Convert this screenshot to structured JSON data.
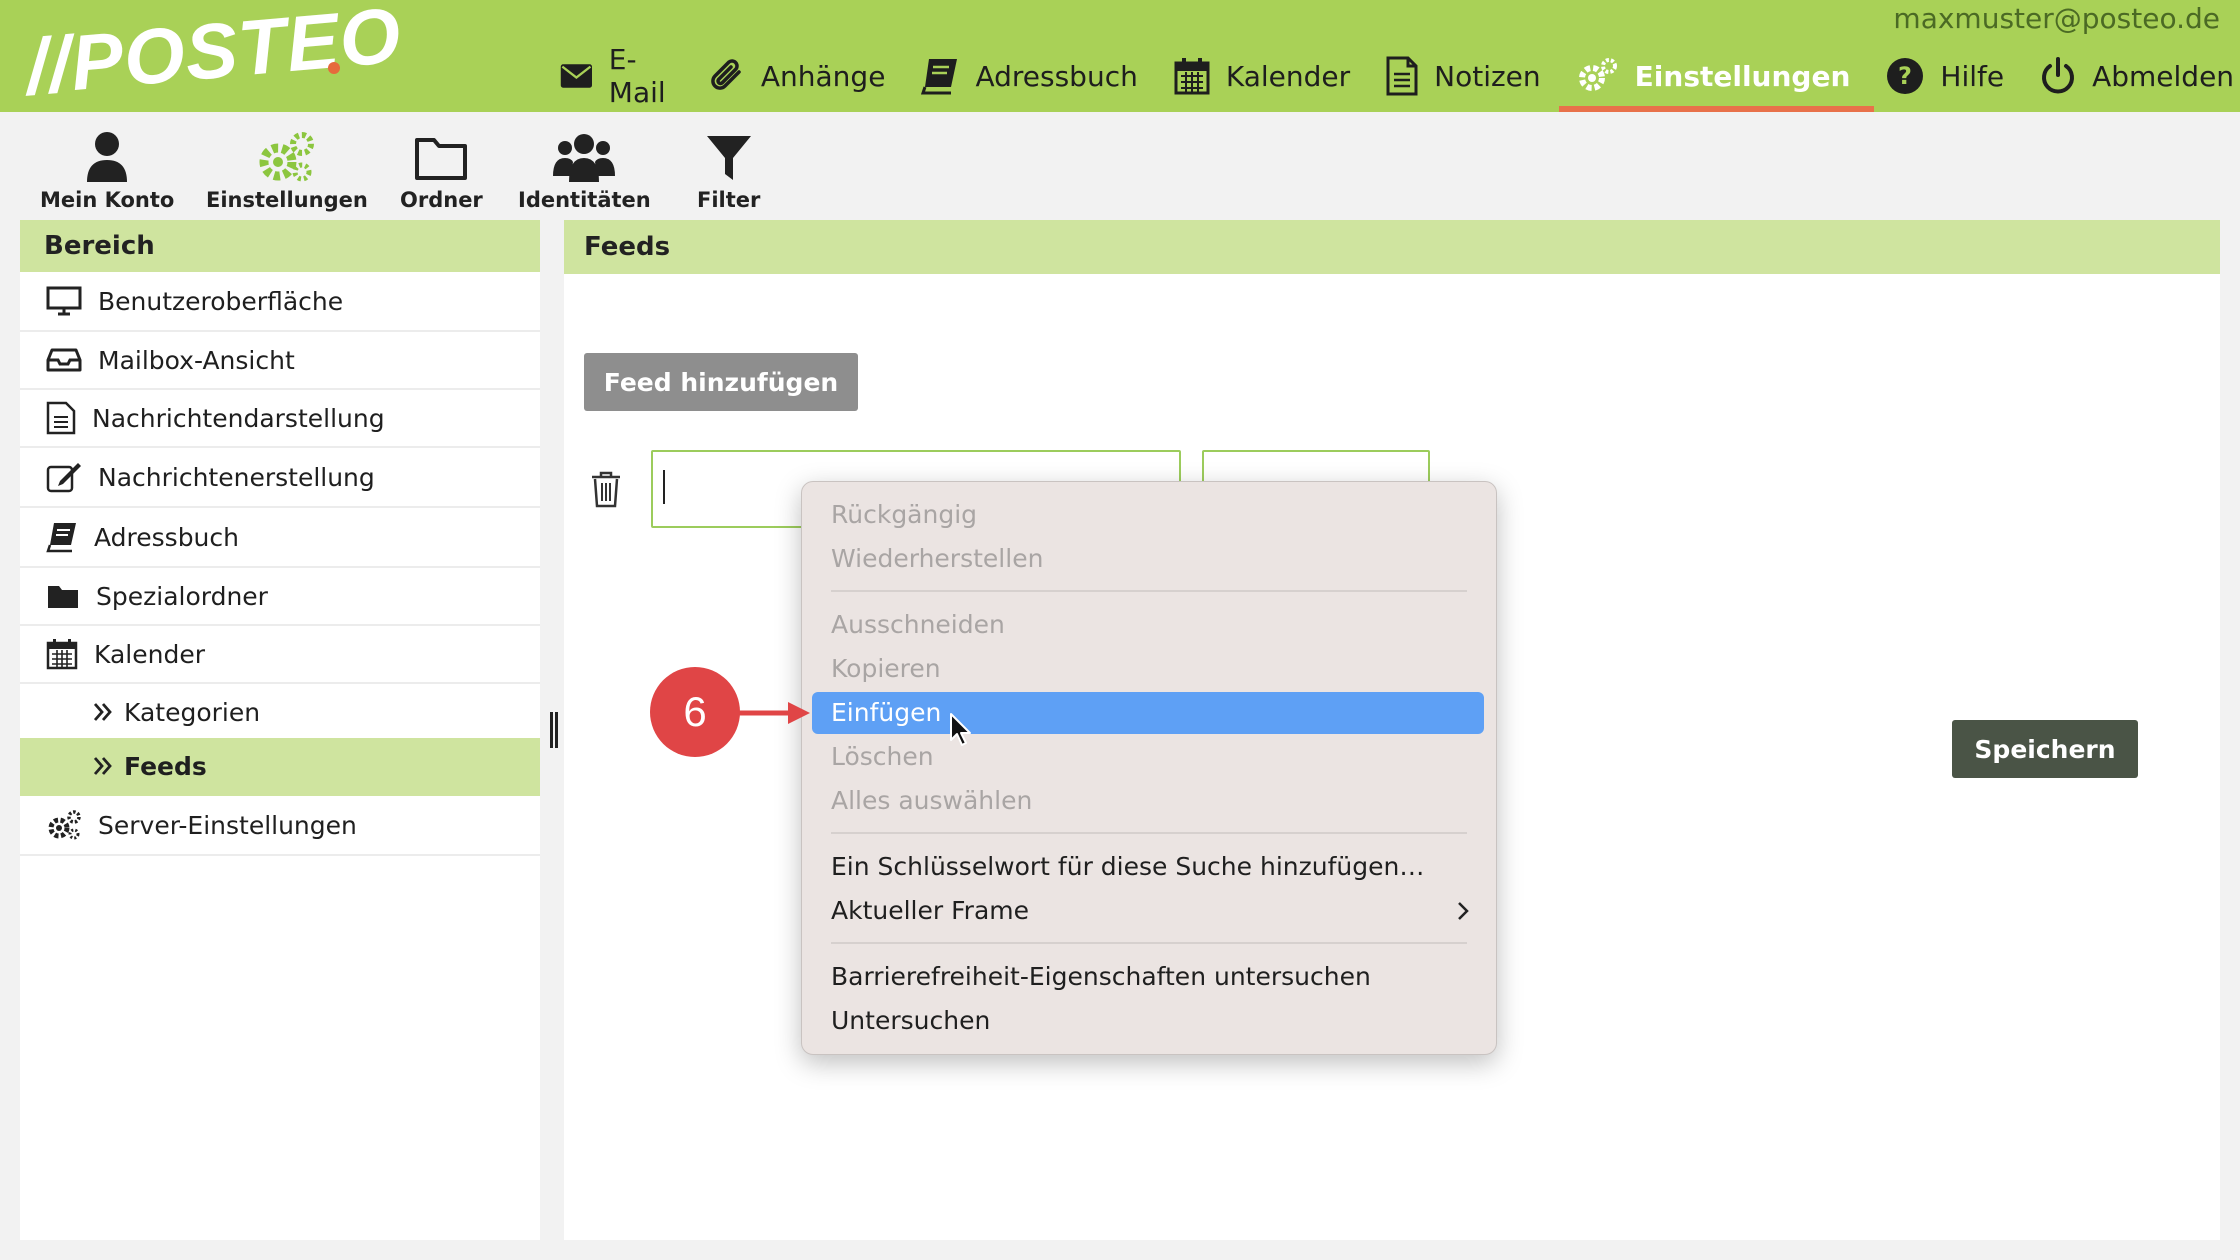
{
  "header": {
    "account": "maxmuster@posteo.de",
    "logo": "//POSTEO",
    "nav": [
      {
        "label": "E-Mail",
        "icon": "envelope-icon"
      },
      {
        "label": "Anhänge",
        "icon": "paperclip-icon"
      },
      {
        "label": "Adressbuch",
        "icon": "address-book-icon"
      },
      {
        "label": "Kalender",
        "icon": "calendar-icon"
      },
      {
        "label": "Notizen",
        "icon": "note-icon"
      },
      {
        "label": "Einstellungen",
        "icon": "gears-icon",
        "active": true
      },
      {
        "label": "Hilfe",
        "icon": "help-icon"
      },
      {
        "label": "Abmelden",
        "icon": "power-icon"
      }
    ]
  },
  "toolbar": {
    "items": [
      {
        "label": "Mein Konto",
        "icon": "user-icon"
      },
      {
        "label": "Einstellungen",
        "icon": "gears-icon"
      },
      {
        "label": "Ordner",
        "icon": "folder-icon"
      },
      {
        "label": "Identitäten",
        "icon": "users-icon"
      },
      {
        "label": "Filter",
        "icon": "filter-icon"
      }
    ]
  },
  "sidebar": {
    "heading": "Bereich",
    "items": [
      {
        "label": "Benutzeroberfläche",
        "icon": "monitor-icon"
      },
      {
        "label": "Mailbox-Ansicht",
        "icon": "inbox-icon"
      },
      {
        "label": "Nachrichtendarstellung",
        "icon": "document-icon"
      },
      {
        "label": "Nachrichtenerstellung",
        "icon": "compose-icon"
      },
      {
        "label": "Adressbuch",
        "icon": "address-book-icon"
      },
      {
        "label": "Spezialordner",
        "icon": "folder-icon"
      },
      {
        "label": "Kalender",
        "icon": "calendar-icon"
      },
      {
        "label": "Kategorien",
        "icon": "double-chevron-icon"
      },
      {
        "label": "Feeds",
        "icon": "double-chevron-icon",
        "selected": true
      },
      {
        "label": "Server-Einstellungen",
        "icon": "gears-icon"
      }
    ]
  },
  "main": {
    "heading": "Feeds",
    "add_button": "Feed hinzufügen",
    "feed_input_value": "",
    "save_button": "Speichern"
  },
  "context_menu": {
    "items": [
      {
        "label": "Rückgängig",
        "disabled": true
      },
      {
        "label": "Wiederherstellen",
        "disabled": true
      },
      {
        "label": "Ausschneiden",
        "disabled": true
      },
      {
        "label": "Kopieren",
        "disabled": true
      },
      {
        "label": "Einfügen",
        "highlighted": true
      },
      {
        "label": "Löschen",
        "disabled": true
      },
      {
        "label": "Alles auswählen",
        "disabled": true
      },
      {
        "label": "Ein Schlüsselwort für diese Suche hinzufügen…"
      },
      {
        "label": "Aktueller Frame",
        "submenu": true
      },
      {
        "label": "Barrierefreiheit-Eigenschaften untersuchen"
      },
      {
        "label": "Untersuchen"
      }
    ]
  },
  "annotation": {
    "step": "6"
  },
  "colors": {
    "brand_green": "#a9d157",
    "light_green": "#cfe49f",
    "accent_orange": "#e8714a",
    "highlight_blue": "#5ea0f5",
    "step_red": "#e04546"
  }
}
